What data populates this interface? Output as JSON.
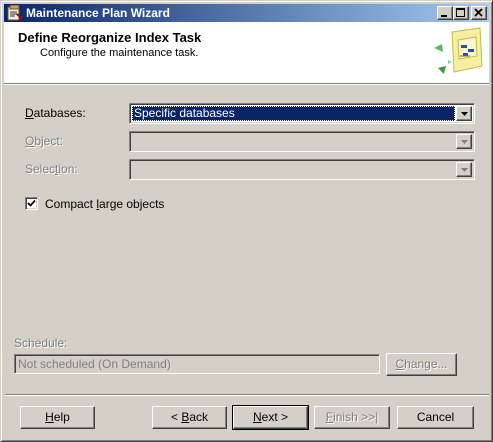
{
  "window": {
    "title": "Maintenance Plan Wizard"
  },
  "header": {
    "title": "Define Reorganize Index Task",
    "subtitle": "Configure the maintenance task."
  },
  "form": {
    "databases": {
      "label_accel": "D",
      "label_rest": "atabases:",
      "value": "Specific databases"
    },
    "object": {
      "label_accel": "O",
      "label_rest": "bject:",
      "value": ""
    },
    "selection": {
      "label_pre": "Selec",
      "label_accel": "t",
      "label_rest": "ion:",
      "value": ""
    },
    "compact": {
      "label_pre": "Compact ",
      "label_accel": "l",
      "label_rest": "arge objects",
      "checked": true
    }
  },
  "schedule": {
    "label": "Schedule:",
    "value": "Not scheduled (On Demand)",
    "change_accel": "C",
    "change_rest": "hange..."
  },
  "buttons": {
    "help": {
      "accel": "H",
      "rest": "elp"
    },
    "back": {
      "pre": "< ",
      "accel": "B",
      "rest": "ack"
    },
    "next": {
      "accel": "N",
      "rest": "ext >"
    },
    "finish": {
      "accel": "F",
      "rest": "inish >>|"
    },
    "cancel": "Cancel"
  },
  "colors": {
    "title_bar_start": "#0a246a",
    "title_bar_end": "#a6caf0",
    "selection_highlight": "#0a246a",
    "face": "#d4d0c8"
  },
  "icons": [
    "app-icon",
    "minimize-icon",
    "maximize-icon",
    "close-icon",
    "dropdown-arrow-icon",
    "checkmark-icon",
    "wizard-header-graphic"
  ]
}
